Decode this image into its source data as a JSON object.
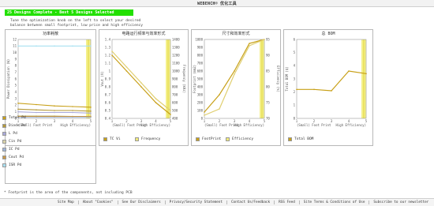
{
  "window": {
    "title": "WEBENCH® 优化工具"
  },
  "status": {
    "banner": "25 Designs Complete - Best 5 Designs Selected"
  },
  "instruction": {
    "line1": "Tune the optimization knob on the left to select your desired",
    "line2": "balance between small footprint, low price and high efficiency"
  },
  "colors": {
    "banner": "#22e000",
    "gold": "#c8a018",
    "highlight": "#f4f08a"
  },
  "charts": [
    {
      "title": "功率耗散",
      "ylabel": "Power Dissipation (W)",
      "yticks": [
        "0",
        "1",
        "2",
        "3",
        "4",
        "5",
        "6",
        "7",
        "8",
        "9",
        "10",
        "11",
        "12"
      ],
      "xticks": [
        "1",
        "2",
        "3",
        "4",
        "5"
      ],
      "xcaption": {
        "left": "(Small) Foot Print",
        "right": "High Efficiency)"
      }
    },
    {
      "title": "电路运行频率与效率形式",
      "ylabel_left": "Vout (V)",
      "ylabel_right": "Frequency (kHz)",
      "yticks": [
        "0.4",
        "0.5",
        "0.6",
        "0.7",
        "0.8",
        "0.9",
        "1",
        "1.1",
        "1.2",
        "1.3",
        "1.4"
      ],
      "yticks_right": [
        "400",
        "500",
        "600",
        "700",
        "800",
        "900",
        "1000",
        "1100",
        "1200",
        "1300",
        "1400"
      ],
      "xticks": [
        "1",
        "2",
        "3",
        "4",
        "5"
      ],
      "xcaption": {
        "left": "(Small) Foot Print",
        "right": "High Efficiency)"
      },
      "legend": [
        "TC Vi",
        "Frequency"
      ]
    },
    {
      "title": "尺寸和效率形式",
      "ylabel_left": "Footprint (mm2)",
      "ylabel_right": "Efficiency (%)",
      "yticks": [
        "0",
        "100",
        "200",
        "300",
        "400",
        "500",
        "600",
        "700",
        "800",
        "900",
        "1000"
      ],
      "yticks_right": [
        "70",
        "75",
        "80",
        "85",
        "90",
        "95"
      ],
      "xticks": [
        "1",
        "2",
        "3",
        "4",
        "5"
      ],
      "xcaption": {
        "left": "(Small) Foot Print",
        "right": "High Efficiency)"
      },
      "legend": [
        "FootPrint",
        "Efficiency"
      ]
    },
    {
      "title": "总 BOM",
      "ylabel": "Total BOM ($)",
      "yticks": [
        "0",
        "1",
        "2",
        "3",
        "4",
        "5",
        "6"
      ],
      "xticks": [
        "1",
        "2",
        "3",
        "4",
        "5"
      ],
      "xcaption": {
        "left": "(Small) Foot Print",
        "right": "High Efficiency)"
      },
      "legend": [
        "Total BOM"
      ]
    }
  ],
  "chart_data": [
    {
      "type": "line",
      "x": [
        1,
        2,
        3,
        4,
        5
      ],
      "ylim": [
        0,
        12
      ],
      "series": [
        {
          "name": "Total Pd",
          "color": "#c8a018",
          "values": [
            2.3,
            2.1,
            1.9,
            1.8,
            1.7
          ]
        },
        {
          "name": "Diode Pd",
          "color": "#b59a3a",
          "values": [
            1.4,
            1.3,
            1.2,
            1.2,
            1.1
          ]
        },
        {
          "name": "L Pd",
          "color": "#a8a8d8",
          "values": [
            1.0,
            0.9,
            0.9,
            0.9,
            0.8
          ]
        },
        {
          "name": "Cin Pd",
          "color": "#d8d2a8",
          "values": [
            0.4,
            0.4,
            0.4,
            0.3,
            0.3
          ]
        },
        {
          "name": "IC Pd",
          "color": "#9fb4d8",
          "values": [
            0.2,
            0.2,
            0.2,
            0.2,
            0.2
          ]
        },
        {
          "name": "Cout Pd",
          "color": "#c89848",
          "values": [
            0.3,
            0.3,
            0.3,
            0.3,
            0.3
          ]
        },
        {
          "name": "ISR Pd",
          "color": "#a8e0f0",
          "values": [
            11.0,
            11.0,
            11.0,
            11.0,
            11.0
          ]
        }
      ]
    },
    {
      "type": "line",
      "x": [
        1,
        2,
        3,
        4,
        5
      ],
      "series": [
        {
          "name": "TC Vi",
          "color": "#c8a018",
          "values": [
            1.2,
            1.0,
            0.8,
            0.6,
            0.45
          ]
        },
        {
          "name": "Frequency",
          "color": "#e0cf70",
          "values": [
            1250,
            1050,
            850,
            650,
            500
          ]
        }
      ]
    },
    {
      "type": "line",
      "x": [
        1,
        2,
        3,
        4,
        5
      ],
      "series": [
        {
          "name": "FootPrint",
          "color": "#c8a018",
          "values": [
            80,
            300,
            600,
            950,
            1000
          ]
        },
        {
          "name": "Efficiency",
          "color": "#e0cf70",
          "values": [
            71,
            73,
            84,
            93,
            95
          ]
        }
      ]
    },
    {
      "type": "line",
      "x": [
        1,
        2,
        3,
        4,
        5
      ],
      "ylim": [
        0,
        6
      ],
      "series": [
        {
          "name": "Total BOM",
          "color": "#c8a018",
          "values": [
            2.2,
            2.2,
            2.1,
            3.6,
            3.4
          ]
        }
      ]
    }
  ],
  "footnote": "* Footprint is the area of the components, not including PCB",
  "footer": {
    "links": [
      "Site Map",
      "About \"Cookies\"",
      "See Our Disclaimers",
      "Privacy/Security Statement",
      "Contact Us/Feedback",
      "RSS Feed",
      "Site Terms & Conditions of Use",
      "Subscribe to our newsletter"
    ]
  }
}
